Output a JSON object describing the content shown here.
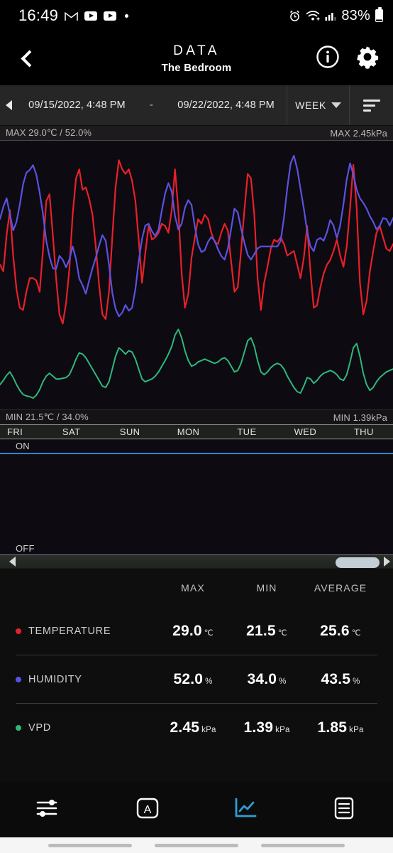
{
  "statusbar": {
    "time": "16:49",
    "battery_percent": "83%",
    "icons": [
      "gmail-icon",
      "youtube-icon",
      "youtube-icon",
      "dot-icon",
      "alarm-icon",
      "wifi-icon",
      "signal-icon",
      "battery-icon"
    ]
  },
  "header": {
    "title": "DATA",
    "subtitle": "The Bedroom",
    "back_icon": "chevron-left-icon",
    "info_icon": "info-icon",
    "settings_icon": "gear-icon"
  },
  "daterange": {
    "prev_icon": "triangle-left-icon",
    "start": "09/15/2022, 4:48 PM",
    "dash": "-",
    "end": "09/22/2022, 4:48 PM",
    "period": "WEEK",
    "period_caret": "chevron-down-icon",
    "filter_icon": "filter-icon"
  },
  "chart_band": {
    "max_left": "MAX 29.0℃ / 52.0%",
    "max_right": "MAX 2.45kPa",
    "min_left": "MIN 21.5℃ / 34.0%",
    "min_right": "MIN 1.39kPa"
  },
  "day_axis": [
    "FRI",
    "SAT",
    "SUN",
    "MON",
    "TUE",
    "WED",
    "THU"
  ],
  "onoff_chart": {
    "on_label": "ON",
    "off_label": "OFF",
    "line_color": "#2a86c8"
  },
  "scrollbar": {
    "left_arrow": "arrow-left-icon",
    "right_arrow": "arrow-right-icon"
  },
  "stats": {
    "columns": [
      "MAX",
      "MIN",
      "AVERAGE"
    ],
    "rows": [
      {
        "label": "TEMPERATURE",
        "color": "#e8202a",
        "max": "29.0",
        "max_unit": "℃",
        "min": "21.5",
        "min_unit": "℃",
        "avg": "25.6",
        "avg_unit": "℃"
      },
      {
        "label": "HUMIDITY",
        "color": "#5a52e0",
        "max": "52.0",
        "max_unit": "%",
        "min": "34.0",
        "min_unit": "%",
        "avg": "43.5",
        "avg_unit": "%"
      },
      {
        "label": "VPD",
        "color": "#2eb87a",
        "max": "2.45",
        "max_unit": "kPa",
        "min": "1.39",
        "min_unit": "kPa",
        "avg": "1.85",
        "avg_unit": "kPa"
      }
    ]
  },
  "bottom_nav": {
    "items": [
      {
        "name": "controls-sliders-icon",
        "active": false
      },
      {
        "name": "auto-mode-icon",
        "active": false
      },
      {
        "name": "data-chart-icon",
        "active": true
      },
      {
        "name": "menu-list-icon",
        "active": false
      }
    ],
    "active_color": "#2e9fd8"
  },
  "chart_data": {
    "type": "line",
    "title": "DATA - The Bedroom",
    "xlabel": "",
    "ylabel": "",
    "grid": false,
    "legend_position": "below-table",
    "x_tick_labels": [
      "FRI",
      "SAT",
      "SUN",
      "MON",
      "TUE",
      "WED",
      "THU"
    ],
    "x_range": [
      "09/15/2022, 4:48 PM",
      "09/22/2022, 4:48 PM"
    ],
    "axes": [
      {
        "id": "left",
        "label": "Temperature / Humidity",
        "max_label": "MAX 29.0℃ / 52.0%",
        "min_label": "MIN 21.5℃ / 34.0%",
        "temperature_range": [
          21.5,
          29.0
        ],
        "humidity_range": [
          34.0,
          52.0
        ]
      },
      {
        "id": "right",
        "label": "VPD",
        "max_label": "MAX 2.45kPa",
        "min_label": "MIN 1.39kPa",
        "range": [
          1.39,
          2.45
        ]
      }
    ],
    "series": [
      {
        "name": "TEMPERATURE",
        "unit": "℃",
        "color": "#e8202a",
        "axis": "left",
        "max": 29.0,
        "min": 21.5,
        "average": 25.6,
        "values": [
          24.2,
          23.9,
          25.5,
          26.6,
          24.6,
          23.1,
          22.3,
          22.2,
          23.0,
          23.6,
          23.6,
          23.5,
          23.0,
          24.8,
          27.0,
          27.3,
          25.5,
          23.6,
          22.0,
          21.6,
          22.5,
          24.0,
          26.4,
          28.0,
          28.4,
          27.5,
          27.6,
          27.1,
          26.4,
          25.0,
          23.3,
          22.0,
          21.8,
          23.0,
          25.4,
          27.6,
          28.8,
          28.4,
          28.2,
          28.4,
          27.9,
          27.0,
          25.3,
          23.4,
          24.7,
          25.9,
          25.3,
          25.4,
          25.6,
          26.0,
          25.9,
          25.6,
          26.6,
          28.4,
          26.6,
          23.8,
          22.3,
          22.9,
          24.5,
          25.4,
          26.2,
          26.0,
          26.4,
          26.2,
          25.6,
          25.2,
          25.1,
          25.6,
          26.0,
          25.7,
          24.3,
          23.0,
          23.2,
          24.8,
          26.6,
          28.2,
          28.0,
          26.4,
          23.6,
          22.2,
          23.4,
          24.1,
          24.9,
          25.3,
          25.2,
          25.4,
          25.1,
          24.6,
          24.7,
          24.8,
          24.2,
          23.6,
          24.5,
          25.9,
          23.9,
          22.3,
          22.4,
          23.2,
          23.8,
          24.2,
          24.4,
          24.8,
          25.3,
          24.6,
          24.1,
          25.0,
          26.7,
          28.6,
          26.7,
          23.4,
          22.0,
          22.6,
          23.9,
          24.8,
          25.6,
          25.9,
          25.4,
          24.9,
          24.8,
          25.1
        ]
      },
      {
        "name": "HUMIDITY",
        "unit": "%",
        "color": "#5a52e0",
        "axis": "left",
        "max": 52.0,
        "min": 34.0,
        "average": 43.5,
        "values": [
          45.3,
          46.6,
          47.5,
          45.8,
          44.1,
          45.0,
          46.8,
          49.0,
          50.2,
          50.5,
          51.0,
          50.0,
          48.1,
          45.9,
          43.0,
          41.3,
          40.1,
          40.0,
          41.4,
          41.0,
          40.2,
          41.0,
          42.4,
          41.1,
          39.0,
          38.3,
          37.4,
          38.8,
          40.1,
          41.2,
          42.5,
          43.6,
          43.0,
          40.5,
          37.5,
          35.8,
          35.0,
          35.4,
          36.2,
          35.6,
          35.9,
          37.9,
          40.8,
          43.2,
          44.6,
          44.8,
          44.0,
          43.5,
          44.2,
          46.2,
          48.0,
          49.1,
          48.2,
          45.6,
          44.2,
          44.8,
          46.5,
          47.3,
          46.8,
          44.5,
          42.6,
          41.8,
          42.0,
          42.9,
          43.4,
          43.0,
          42.1,
          41.4,
          41.0,
          42.2,
          44.3,
          46.4,
          46.0,
          44.3,
          42.8,
          41.5,
          41.0,
          41.6,
          42.2,
          42.4,
          42.4,
          42.4,
          42.4,
          42.4,
          42.4,
          43.0,
          45.5,
          48.6,
          51.2,
          52.0,
          50.6,
          48.5,
          46.4,
          44.0,
          42.4,
          41.9,
          43.1,
          43.3,
          43.0,
          43.9,
          45.2,
          44.6,
          43.3,
          44.6,
          46.9,
          49.5,
          51.2,
          50.0,
          48.4,
          47.5,
          47.0,
          46.4,
          45.6,
          45.0,
          44.2,
          44.6,
          45.4,
          45.3,
          44.6,
          45.4
        ]
      },
      {
        "name": "VPD",
        "unit": "kPa",
        "color": "#2eb87a",
        "axis": "right",
        "max": 2.45,
        "min": 1.39,
        "average": 1.85,
        "values": [
          1.62,
          1.68,
          1.75,
          1.8,
          1.72,
          1.62,
          1.54,
          1.48,
          1.46,
          1.45,
          1.43,
          1.47,
          1.55,
          1.66,
          1.74,
          1.78,
          1.74,
          1.7,
          1.7,
          1.71,
          1.72,
          1.76,
          1.86,
          1.98,
          2.07,
          2.05,
          2.0,
          1.92,
          1.84,
          1.76,
          1.68,
          1.6,
          1.58,
          1.66,
          1.84,
          2.02,
          2.14,
          2.1,
          2.05,
          2.1,
          2.08,
          1.98,
          1.84,
          1.7,
          1.66,
          1.68,
          1.7,
          1.74,
          1.8,
          1.88,
          1.96,
          2.05,
          2.16,
          2.32,
          2.4,
          2.28,
          2.1,
          1.96,
          1.88,
          1.9,
          1.94,
          1.96,
          1.98,
          1.96,
          1.94,
          1.92,
          1.94,
          1.98,
          2.0,
          1.96,
          1.88,
          1.8,
          1.82,
          1.92,
          2.08,
          2.24,
          2.28,
          2.16,
          1.96,
          1.8,
          1.76,
          1.8,
          1.86,
          1.9,
          1.92,
          1.9,
          1.84,
          1.74,
          1.66,
          1.58,
          1.52,
          1.5,
          1.6,
          1.72,
          1.7,
          1.64,
          1.68,
          1.74,
          1.78,
          1.8,
          1.82,
          1.8,
          1.76,
          1.7,
          1.68,
          1.76,
          1.94,
          2.14,
          2.2,
          2.02,
          1.78,
          1.62,
          1.54,
          1.58,
          1.66,
          1.72,
          1.76,
          1.8,
          1.82,
          1.84
        ]
      }
    ],
    "onoff_series": {
      "name": "DEVICE",
      "color": "#2a86c8",
      "on_label": "ON",
      "off_label": "OFF",
      "state": "ON"
    }
  }
}
